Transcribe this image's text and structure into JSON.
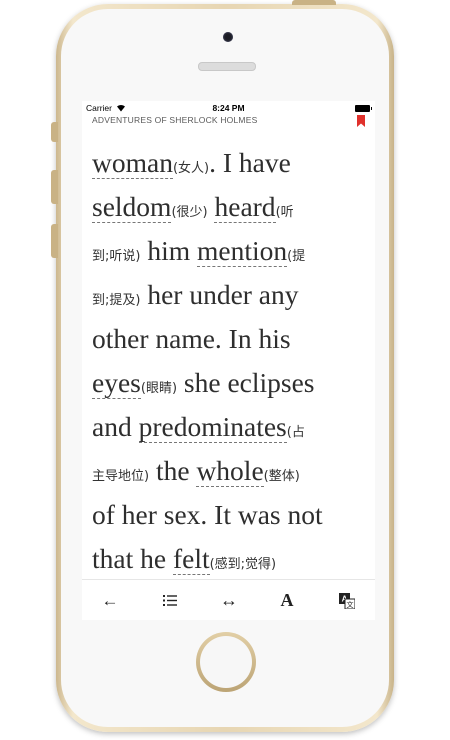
{
  "status_bar": {
    "carrier": "Carrier",
    "time": "8:24 PM"
  },
  "book": {
    "title": "ADVENTURES OF SHERLOCK HOLMES"
  },
  "reader": {
    "lines": [
      [
        {
          "text": "woman",
          "gloss": "(女人)",
          "vocab": true
        },
        {
          "text": ". I have"
        }
      ],
      [
        {
          "text": "seldom",
          "gloss": "(很少)",
          "vocab": true
        },
        {
          "text": " "
        },
        {
          "text": "heard",
          "gloss": "(听",
          "vocab": true
        }
      ],
      [
        {
          "gloss": "到;听说)"
        },
        {
          "text": " him "
        },
        {
          "text": "mention",
          "gloss": "(提",
          "vocab": true
        }
      ],
      [
        {
          "gloss": "到;提及)"
        },
        {
          "text": " her under any"
        }
      ],
      [
        {
          "text": "other name. In his"
        }
      ],
      [
        {
          "text": "eyes",
          "gloss": "(眼睛)",
          "vocab": true
        },
        {
          "text": " she eclipses"
        }
      ],
      [
        {
          "text": "and "
        },
        {
          "text": "predominates",
          "gloss": "(占",
          "vocab": true
        }
      ],
      [
        {
          "gloss": "主导地位)"
        },
        {
          "text": " the "
        },
        {
          "text": "whole",
          "gloss": "(整体)",
          "vocab": true
        }
      ],
      [
        {
          "text": "of her sex. It was not"
        }
      ],
      [
        {
          "text": "that he "
        },
        {
          "text": "felt",
          "gloss": "(感到;觉得)",
          "vocab": true
        }
      ]
    ]
  },
  "toolbar": {
    "back": "←",
    "contents": "☰",
    "resize": "↔",
    "font": "A",
    "translate": "translate-icon"
  },
  "colors": {
    "bookmark": "#e0312c",
    "text": "#2e2e2e"
  }
}
